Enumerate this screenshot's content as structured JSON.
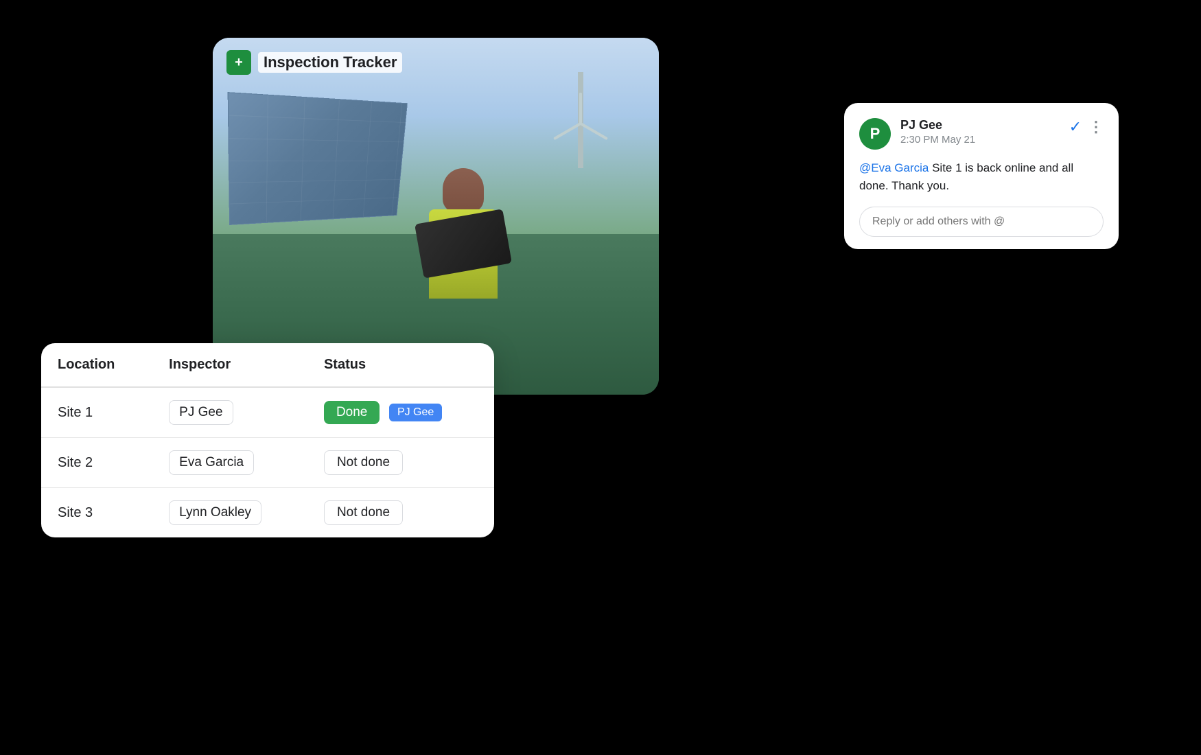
{
  "tracker": {
    "title": "Inspection Tracker",
    "logo_letter": "+"
  },
  "table": {
    "columns": [
      "Location",
      "Inspector",
      "Status"
    ],
    "rows": [
      {
        "location": "Site 1",
        "inspector": "PJ Gee",
        "status": "Done",
        "status_type": "done",
        "tooltip": "PJ Gee"
      },
      {
        "location": "Site 2",
        "inspector": "Eva Garcia",
        "status": "Not done",
        "status_type": "not-done",
        "tooltip": ""
      },
      {
        "location": "Site 3",
        "inspector": "Lynn Oakley",
        "status": "Not done",
        "status_type": "not-done",
        "tooltip": ""
      }
    ]
  },
  "comment": {
    "author": "PJ Gee",
    "time": "2:30 PM May 21",
    "avatar_letter": "P",
    "mention": "@Eva Garcia",
    "message_after_mention": " Site 1 is back online and all done. Thank you.",
    "reply_placeholder": "Reply or add others with @"
  }
}
